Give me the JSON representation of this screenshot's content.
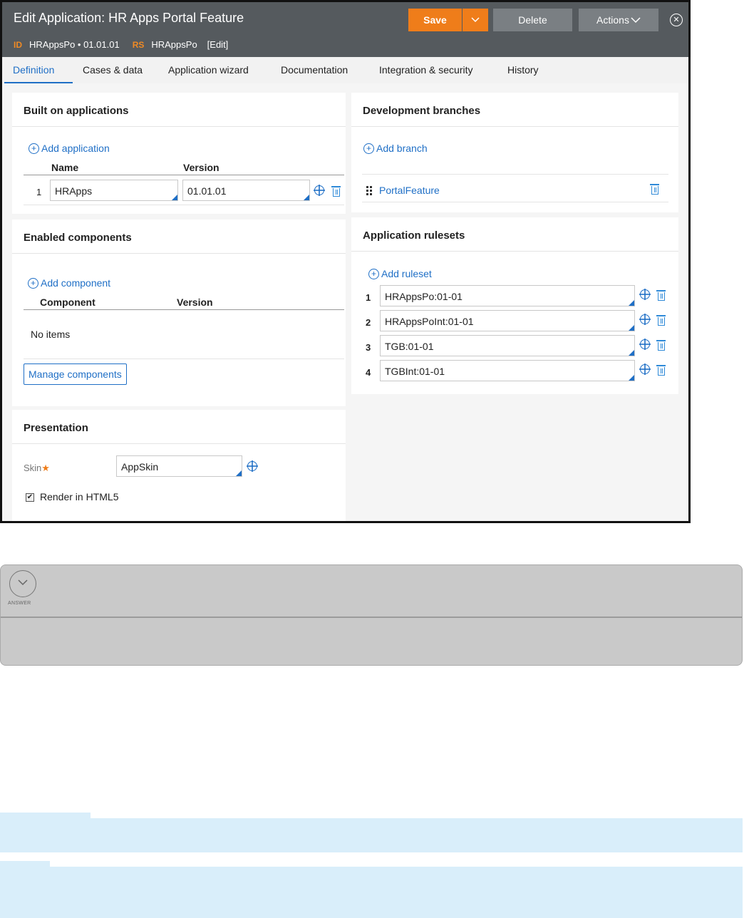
{
  "header": {
    "title": "Edit Application: HR Apps Portal Feature",
    "id_label": "ID",
    "id_value": "HRAppsPo • 01.01.01",
    "rs_label": "RS",
    "rs_value": "HRAppsPo",
    "edit_label": "[Edit]",
    "save_label": "Save",
    "delete_label": "Delete",
    "actions_label": "Actions"
  },
  "tabs": [
    {
      "label": "Definition",
      "active": true
    },
    {
      "label": "Cases & data"
    },
    {
      "label": "Application wizard"
    },
    {
      "label": "Documentation"
    },
    {
      "label": "Integration & security"
    },
    {
      "label": "History"
    }
  ],
  "built_on": {
    "title": "Built on applications",
    "add_label": "Add application",
    "col_name": "Name",
    "col_version": "Version",
    "rows": [
      {
        "num": "1",
        "name": "HRApps",
        "version": "01.01.01"
      }
    ]
  },
  "enabled_components": {
    "title": "Enabled components",
    "add_label": "Add component",
    "col_component": "Component",
    "col_version": "Version",
    "empty_text": "No items",
    "manage_label": "Manage components"
  },
  "presentation": {
    "title": "Presentation",
    "skin_label": "Skin",
    "required_mark": "★",
    "skin_value": "AppSkin",
    "render_label": "Render in HTML5",
    "render_checked": true
  },
  "dev_branches": {
    "title": "Development branches",
    "add_label": "Add branch",
    "branch": "PortalFeature"
  },
  "rulesets": {
    "title": "Application rulesets",
    "add_label": "Add ruleset",
    "rows": [
      {
        "num": "1",
        "value": "HRAppsPo:01-01"
      },
      {
        "num": "2",
        "value": "HRAppsPoInt:01-01"
      },
      {
        "num": "3",
        "value": "TGB:01-01"
      },
      {
        "num": "4",
        "value": "TGBInt:01-01"
      }
    ]
  },
  "answer": {
    "label": "ANSWER"
  },
  "colors": {
    "header_bg": "#555a5e",
    "accent_orange": "#ef7d1a",
    "link_blue": "#1f6fc6",
    "info_blue": "#d9eefa"
  }
}
